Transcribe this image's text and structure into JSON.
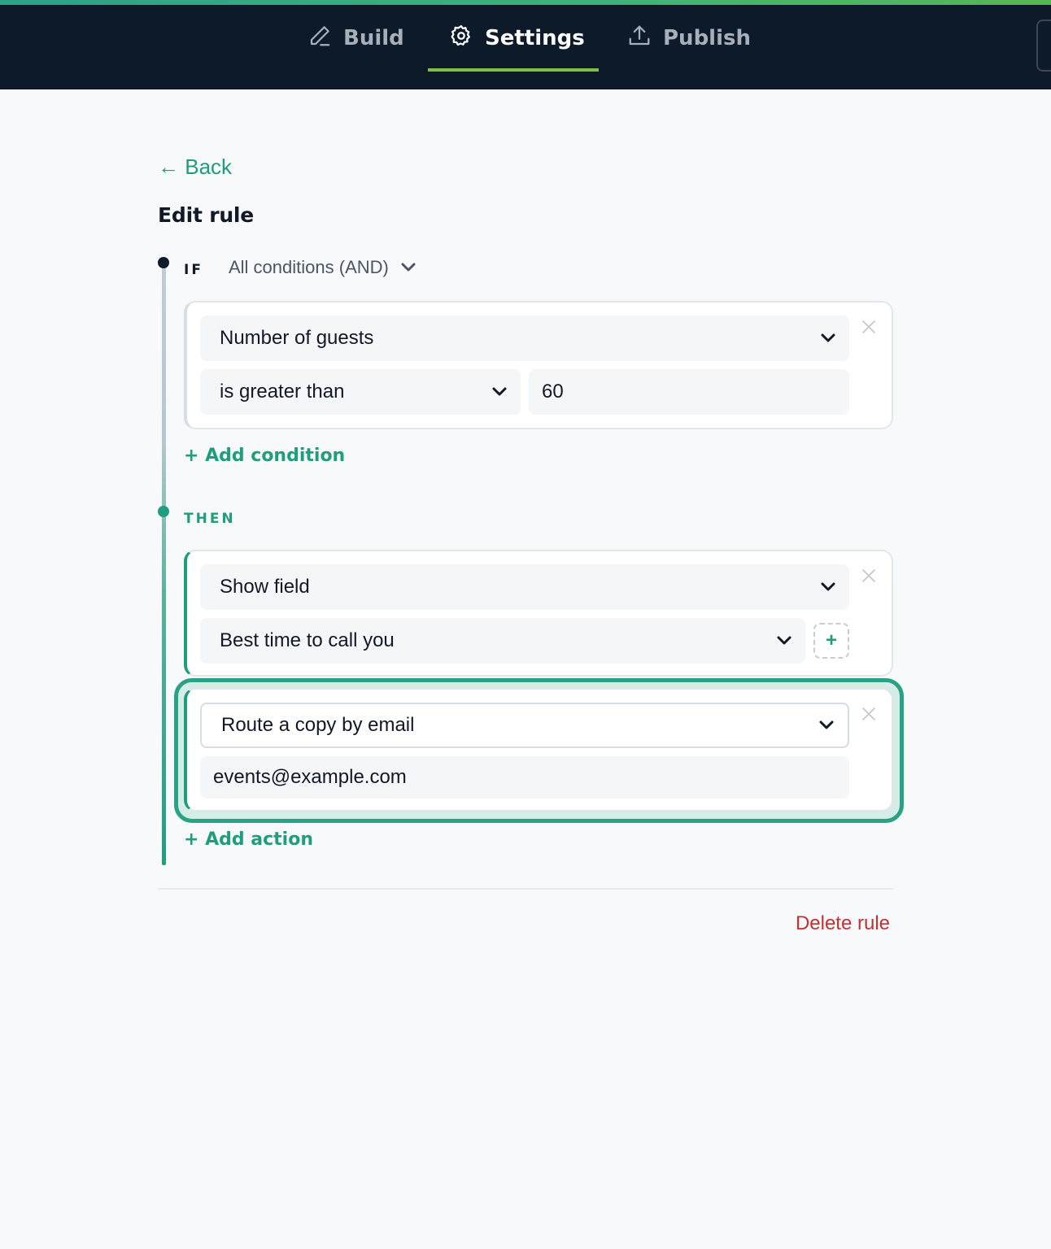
{
  "nav": {
    "tabs": [
      {
        "label": "Build",
        "icon": "pencil-icon",
        "active": false
      },
      {
        "label": "Settings",
        "icon": "gear-icon",
        "active": true
      },
      {
        "label": "Publish",
        "icon": "upload-icon",
        "active": false
      }
    ]
  },
  "colors": {
    "accent": "#1f9e7d",
    "nav_bg": "#0d1a2a",
    "active_underline": "#7cc23e",
    "danger": "#c53030"
  },
  "back_label": "← Back",
  "title": "Edit rule",
  "if_section": {
    "label": "IF",
    "match_mode": "All conditions (AND)",
    "conditions": [
      {
        "field": "Number of guests",
        "operator": "is greater than",
        "value": "60"
      }
    ],
    "add_label": "+ Add condition"
  },
  "then_section": {
    "label": "THEN",
    "actions": [
      {
        "type": "Show field",
        "target": "Best time to call you",
        "add_button": "+"
      },
      {
        "type": "Route a copy by email",
        "target": "events@example.com"
      }
    ],
    "add_label": "+ Add action"
  },
  "delete_label": "Delete rule"
}
